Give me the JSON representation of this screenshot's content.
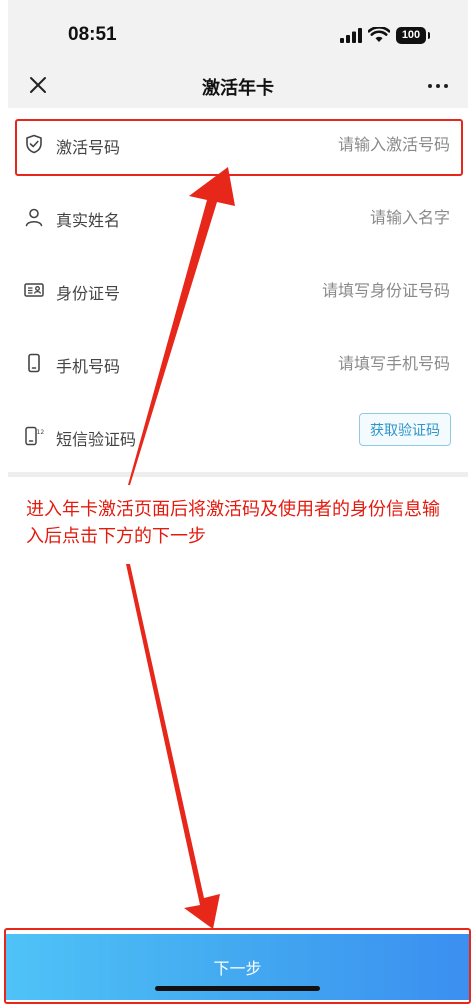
{
  "status_bar": {
    "time": "08:51",
    "battery": "100"
  },
  "nav": {
    "title": "激活年卡"
  },
  "form": {
    "rows": [
      {
        "label": "激活号码",
        "placeholder": "请输入激活号码",
        "icon": "shield-check-icon"
      },
      {
        "label": "真实姓名",
        "placeholder": "请输入名字",
        "icon": "person-icon"
      },
      {
        "label": "身份证号",
        "placeholder": "请填写身份证号码",
        "icon": "id-card-icon"
      },
      {
        "label": "手机号码",
        "placeholder": "请填写手机号码",
        "icon": "phone-icon"
      },
      {
        "label": "短信验证码",
        "icon": "sms-code-icon"
      }
    ],
    "sms_button": "获取验证码"
  },
  "annotation": {
    "text": "进入年卡激活页面后将激活码及使用者的身份信息输入后点击下方的下一步"
  },
  "footer": {
    "next_label": "下一步"
  },
  "colors": {
    "annotation": "#e31b0f",
    "button_gradient_start": "#4fc3f7",
    "button_gradient_end": "#3b8ff0"
  }
}
